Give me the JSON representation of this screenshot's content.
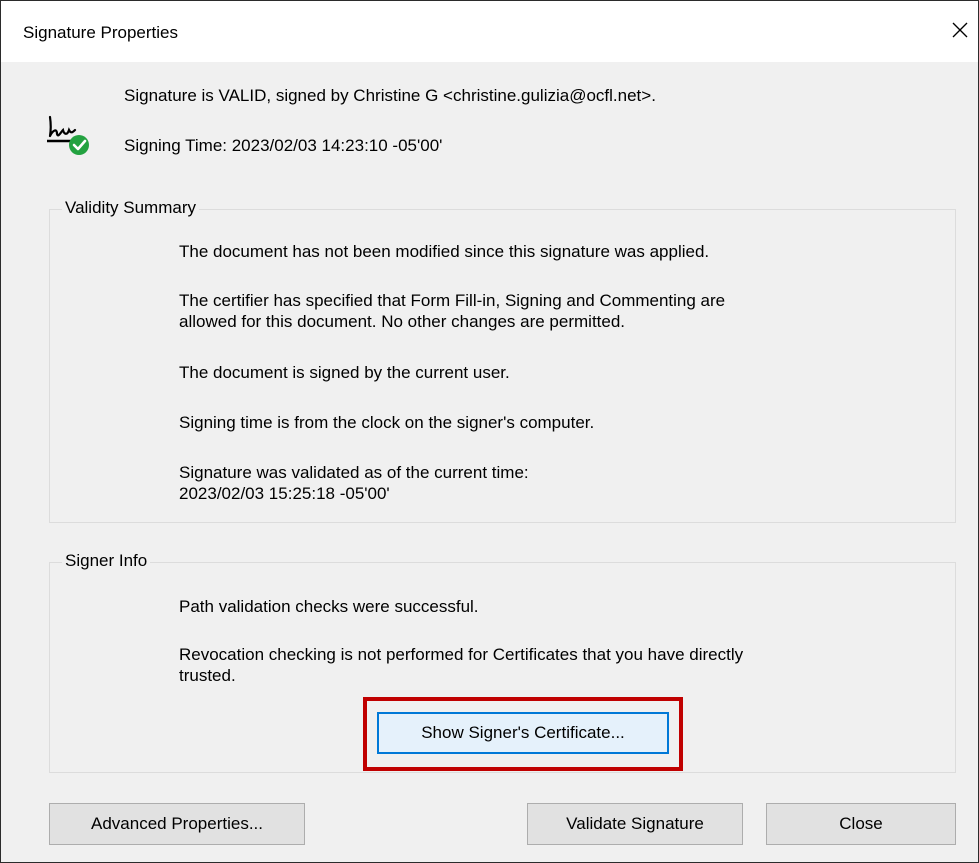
{
  "window": {
    "title": "Signature Properties",
    "close_icon": "close-icon"
  },
  "status": {
    "icon": "signature-valid-icon",
    "valid_line": "Signature is VALID, signed by Christine G <christine.gulizia@ocfl.net>.",
    "signing_time": "Signing Time:  2023/02/03 14:23:10 -05'00'"
  },
  "validity_summary": {
    "legend": "Validity Summary",
    "items": [
      "The document has not been modified since this signature was applied.",
      "The certifier has specified that Form Fill-in, Signing and Commenting are",
      "allowed for this document. No other changes are permitted.",
      "The document is signed by the current user.",
      "Signing time is from the clock on the signer's computer.",
      "Signature was validated as of the current time:",
      "2023/02/03 15:25:18 -05'00'"
    ]
  },
  "signer_info": {
    "legend": "Signer Info",
    "items": [
      "Path validation checks were successful.",
      "Revocation checking is not performed for Certificates that you have directly",
      "trusted."
    ],
    "show_certificate_label": "Show Signer's Certificate..."
  },
  "buttons": {
    "advanced": "Advanced Properties...",
    "validate": "Validate Signature",
    "close": "Close"
  },
  "colors": {
    "highlight": "#c00000",
    "focus": "#0078d7",
    "valid_check": "#23a240"
  }
}
